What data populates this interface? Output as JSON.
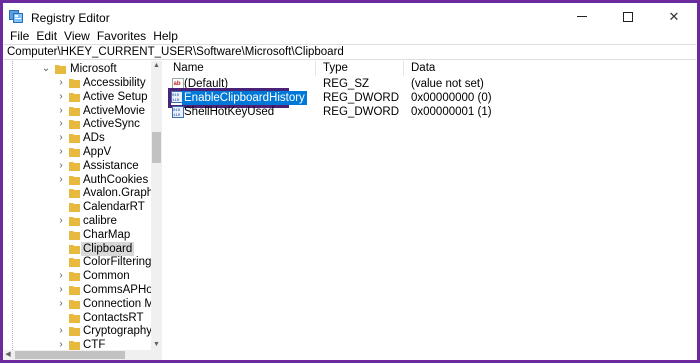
{
  "window": {
    "title": "Registry Editor",
    "minimize_icon": "minimize-icon",
    "maximize_icon": "maximize-icon",
    "close_icon": "close-icon",
    "close_glyph": "✕"
  },
  "menu": [
    "File",
    "Edit",
    "View",
    "Favorites",
    "Help"
  ],
  "address": "Computer\\HKEY_CURRENT_USER\\Software\\Microsoft\\Clipboard",
  "tree": {
    "parent": "Microsoft",
    "items": [
      {
        "label": "Accessibility",
        "expandable": true
      },
      {
        "label": "Active Setup",
        "expandable": true
      },
      {
        "label": "ActiveMovie",
        "expandable": true
      },
      {
        "label": "ActiveSync",
        "expandable": true
      },
      {
        "label": "ADs",
        "expandable": true
      },
      {
        "label": "AppV",
        "expandable": true
      },
      {
        "label": "Assistance",
        "expandable": true
      },
      {
        "label": "AuthCookies",
        "expandable": true
      },
      {
        "label": "Avalon.Graphics",
        "expandable": false
      },
      {
        "label": "CalendarRT",
        "expandable": false
      },
      {
        "label": "calibre",
        "expandable": true
      },
      {
        "label": "CharMap",
        "expandable": false
      },
      {
        "label": "Clipboard",
        "expandable": false,
        "selected": true
      },
      {
        "label": "ColorFiltering",
        "expandable": false
      },
      {
        "label": "Common",
        "expandable": true
      },
      {
        "label": "CommsAPHost",
        "expandable": true
      },
      {
        "label": "Connection Manag",
        "expandable": true
      },
      {
        "label": "ContactsRT",
        "expandable": false
      },
      {
        "label": "Cryptography",
        "expandable": true
      },
      {
        "label": "CTF",
        "expandable": true
      }
    ]
  },
  "columns": {
    "name": "Name",
    "type": "Type",
    "data": "Data"
  },
  "values": [
    {
      "name": "(Default)",
      "type": "REG_SZ",
      "data": "(value not set)",
      "icon": "string-value-icon"
    },
    {
      "name": "EnableClipboardHistory",
      "type": "REG_DWORD",
      "data": "0x00000000 (0)",
      "icon": "dword-value-icon",
      "editing": true
    },
    {
      "name": "ShellHotKeyUsed",
      "type": "REG_DWORD",
      "data": "0x00000001 (1)",
      "icon": "dword-value-icon"
    }
  ],
  "colors": {
    "frame": "#6b2b9f",
    "highlight_border": "#4a2378",
    "selection": "#0078d7",
    "folder": "#e8b93f"
  }
}
